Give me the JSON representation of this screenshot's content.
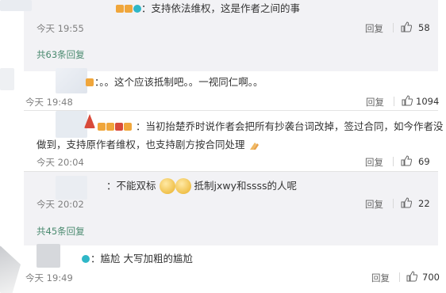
{
  "comments": [
    {
      "text": "：支持依法维权，这是作者之间的事",
      "time": "今天 19:55",
      "reply": "回复",
      "likes": "58"
    },
    {
      "text": "：。。这个应该抵制吧。。一视同仁啊。。",
      "time": "今天 19:48",
      "reply": "回复",
      "likes": "1094"
    },
    {
      "text_line1": "：当初抬楚乔时说作者会把所有抄袭台词改掉，签过合同，如今作者没",
      "text_line2": "做到，支持原作者维权，也支持剧方按合同处理",
      "time": "今天 20:04",
      "reply": "回复",
      "likes": "69"
    },
    {
      "text_a": "：不能双标",
      "text_b": "抵制jxwy和ssss的人呢",
      "time": "今天 20:02",
      "reply": "回复",
      "likes": "22"
    },
    {
      "text": "：尴尬 大写加粗的尴尬",
      "time": "今天 19:49",
      "reply": "回复",
      "likes": "700"
    }
  ],
  "more_links": [
    "共63条回复",
    "共45条回复"
  ],
  "icons": {
    "like": "thumbs-up-icon",
    "vip": "vip-badge-icon",
    "verified": "verified-icon",
    "emoji": "smile-emoji-icon",
    "clap": "clap-emoji-icon"
  },
  "colors": {
    "accent_green": "#4a8a6f",
    "band": "#f2f2f5",
    "text": "#333333",
    "meta": "#808080"
  }
}
